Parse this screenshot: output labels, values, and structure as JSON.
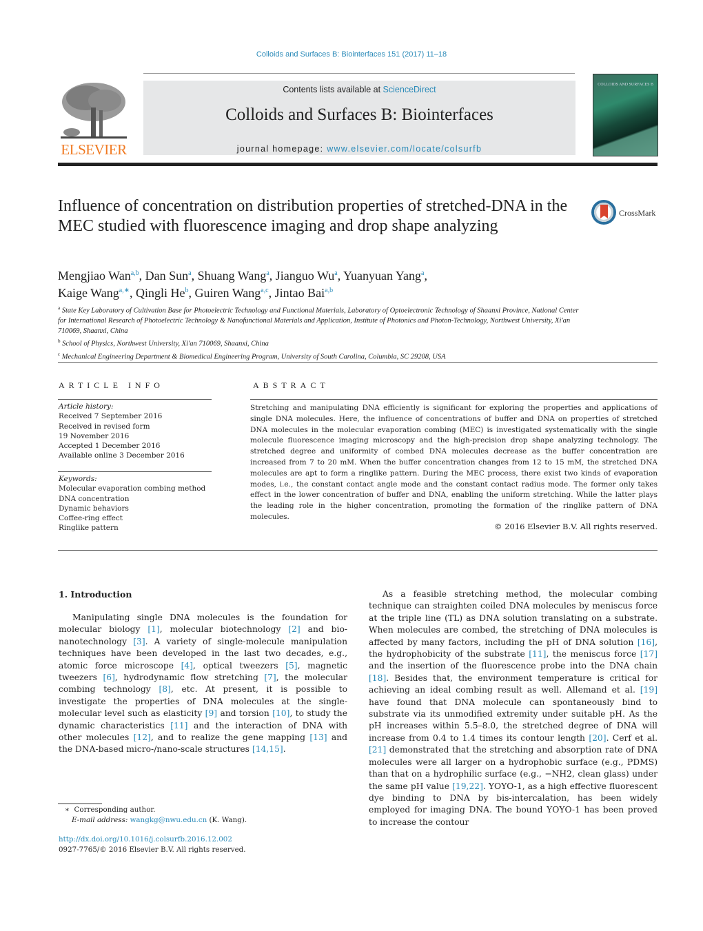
{
  "header": {
    "journal_ref": "Colloids and Surfaces B: Biointerfaces 151 (2017) 11–18",
    "publisher_wordmark": "ELSEVIER",
    "contents_prefix": "Contents lists available at ",
    "contents_link": "ScienceDirect",
    "journal_title": "Colloids and Surfaces B: Biointerfaces",
    "homepage_prefix": "journal homepage: ",
    "homepage_link": "www.elsevier.com/locate/colsurfb",
    "cover_title": "COLLOIDS AND SURFACES B"
  },
  "article": {
    "title": "Influence of concentration on distribution properties of stretched-DNA in the MEC studied with fluorescence imaging and drop shape analyzing",
    "crossmark_label": "CrossMark",
    "authors": [
      {
        "name": "Mengjiao Wan",
        "aff": "a,b",
        "sep": ", "
      },
      {
        "name": "Dan Sun",
        "aff": "a",
        "sep": ", "
      },
      {
        "name": "Shuang Wang",
        "aff": "a",
        "sep": ", "
      },
      {
        "name": "Jianguo Wu",
        "aff": "a",
        "sep": ", "
      },
      {
        "name": "Yuanyuan Yang",
        "aff": "a",
        "sep": ","
      },
      {
        "name": "Kaige Wang",
        "aff": "a,∗",
        "sep": ", "
      },
      {
        "name": "Qingli He",
        "aff": "b",
        "sep": ", "
      },
      {
        "name": "Guiren Wang",
        "aff": "a,c",
        "sep": ", "
      },
      {
        "name": "Jintao Bai",
        "aff": "a,b",
        "sep": ""
      }
    ],
    "affiliations": [
      {
        "mark": "a",
        "text": "State Key Laboratory of Cultivation Base for Photoelectric Technology and Functional Materials, Laboratory of Optoelectronic Technology of Shaanxi Province, National Center for International Research of Photoelectric Technology & Nanofunctional Materials and Application, Institute of Photonics and Photon-Technology, Northwest University, Xi'an 710069, Shaanxi, China"
      },
      {
        "mark": "b",
        "text": "School of Physics, Northwest University, Xi'an 710069, Shaanxi, China"
      },
      {
        "mark": "c",
        "text": "Mechanical Engineering Department & Biomedical Engineering Program, University of South Carolina, Columbia, SC 29208, USA"
      }
    ]
  },
  "article_info": {
    "heading": "ARTICLE INFO",
    "history_label": "Article history:",
    "history": [
      "Received 7 September 2016",
      "Received in revised form",
      "19 November 2016",
      "Accepted 1 December 2016",
      "Available online 3 December 2016"
    ],
    "keywords_label": "Keywords:",
    "keywords": [
      "Molecular evaporation combing method",
      "DNA concentration",
      "Dynamic behaviors",
      "Coffee-ring effect",
      "Ringlike pattern"
    ]
  },
  "abstract": {
    "heading": "ABSTRACT",
    "text": "Stretching and manipulating DNA efficiently is significant for exploring the properties and applications of single DNA molecules. Here, the influence of concentrations of buffer and DNA on properties of stretched DNA molecules in the molecular evaporation combing (MEC) is investigated systematically with the single molecule fluorescence imaging microscopy and the high-precision drop shape analyzing technology. The stretched degree and uniformity of combed DNA molecules decrease as the buffer concentration are increased from 7 to 20 mM. When the buffer concentration changes from 12 to 15 mM, the stretched DNA molecules are apt to form a ringlike pattern. During the MEC process, there exist two kinds of evaporation modes, i.e., the constant contact angle mode and the constant contact radius mode. The former only takes effect in the lower concentration of buffer and DNA, enabling the uniform stretching. While the latter plays the leading role in the higher concentration, promoting the formation of the ringlike pattern of DNA molecules.",
    "copyright": "© 2016 Elsevier B.V. All rights reserved."
  },
  "body": {
    "section_heading": "1.  Introduction",
    "left_paragraph": [
      {
        "t": "Manipulating single DNA molecules is the foundation for molecular biology "
      },
      {
        "r": "[1]"
      },
      {
        "t": ", molecular biotechnology "
      },
      {
        "r": "[2]"
      },
      {
        "t": " and bio-nanotechnology "
      },
      {
        "r": "[3]"
      },
      {
        "t": ". A variety of single-molecule manipulation techniques have been developed in the last two decades, e.g., atomic force microscope "
      },
      {
        "r": "[4]"
      },
      {
        "t": ", optical tweezers "
      },
      {
        "r": "[5]"
      },
      {
        "t": ", magnetic tweezers "
      },
      {
        "r": "[6]"
      },
      {
        "t": ", hydrodynamic flow stretching "
      },
      {
        "r": "[7]"
      },
      {
        "t": ", the molecular combing technology "
      },
      {
        "r": "[8]"
      },
      {
        "t": ", etc. At present, it is possible to investigate the properties of DNA molecules at the single-molecular level such as elasticity "
      },
      {
        "r": "[9]"
      },
      {
        "t": " and torsion "
      },
      {
        "r": "[10]"
      },
      {
        "t": ", to study the dynamic characteristics "
      },
      {
        "r": "[11]"
      },
      {
        "t": " and the interaction of DNA with other molecules "
      },
      {
        "r": "[12]"
      },
      {
        "t": ", and to realize the gene mapping "
      },
      {
        "r": "[13]"
      },
      {
        "t": " and the DNA-based micro-/nano-scale structures "
      },
      {
        "r": "[14,15]"
      },
      {
        "t": "."
      }
    ],
    "right_paragraph": [
      {
        "t": "As a feasible stretching method, the molecular combing technique can straighten coiled DNA molecules by meniscus force at the triple line (TL) as DNA solution translating on a substrate. When molecules are combed, the stretching of DNA molecules is affected by many factors, including the pH of DNA solution "
      },
      {
        "r": "[16]"
      },
      {
        "t": ", the hydrophobicity of the substrate "
      },
      {
        "r": "[11]"
      },
      {
        "t": ", the meniscus force "
      },
      {
        "r": "[17]"
      },
      {
        "t": " and the insertion of the fluorescence probe into the DNA chain "
      },
      {
        "r": "[18]"
      },
      {
        "t": ". Besides that, the environment temperature is critical for achieving an ideal combing result as well. Allemand et al. "
      },
      {
        "r": "[19]"
      },
      {
        "t": " have found that DNA molecule can spontaneously bind to substrate via its unmodified extremity under suitable pH. As the pH increases within 5.5–8.0, the stretched degree of DNA will increase from 0.4 to 1.4 times its contour length "
      },
      {
        "r": "[20]"
      },
      {
        "t": ". Cerf et al. "
      },
      {
        "r": "[21]"
      },
      {
        "t": " demonstrated that the stretching and absorption rate of DNA molecules were all larger on a hydrophobic surface (e.g., PDMS) than that on a hydrophilic surface (e.g., −NH2, clean glass) under the same pH value "
      },
      {
        "r": "[19,22]"
      },
      {
        "t": ". YOYO-1, as a high effective fluorescent dye binding to DNA by bis-intercalation, has been widely employed for imaging DNA. The bound YOYO-1 has been proved to increase the contour"
      }
    ]
  },
  "footnotes": {
    "corresponding_mark": "∗",
    "corresponding_text": "Corresponding author.",
    "email_label": "E-mail address:",
    "email": "wangkg@nwu.edu.cn",
    "email_suffix": " (K. Wang).",
    "doi": "http://dx.doi.org/10.1016/j.colsurfb.2016.12.002",
    "issn_line": "0927-7765/© 2016 Elsevier B.V. All rights reserved."
  },
  "colors": {
    "link": "#2a8ab8",
    "elsevier_orange": "#f07a22",
    "banner_bg": "#e6e7e8"
  }
}
